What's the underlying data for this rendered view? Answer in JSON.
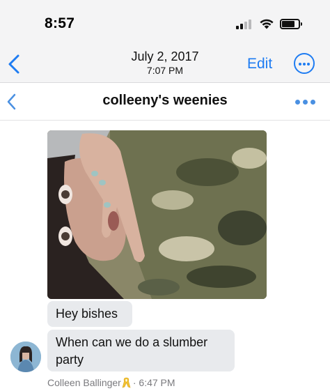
{
  "status_bar": {
    "time": "8:57",
    "signal_bars_filled": 2,
    "signal_bars_total": 4
  },
  "photo_viewer": {
    "date": "July 2, 2017",
    "time": "7:07 PM",
    "edit_label": "Edit",
    "back_icon": "chevron-left-icon",
    "more_icon": "more-circle-icon"
  },
  "conversation": {
    "title": "colleeny's weenies",
    "back_icon": "chevron-left-icon",
    "more_icon": "more-dots-icon"
  },
  "messages": [
    {
      "type": "photo",
      "description_icon": "photo-attachment"
    },
    {
      "type": "text",
      "text": "Hey bishes"
    },
    {
      "type": "text",
      "lines": [
        "When can we do a slumber",
        "party"
      ]
    }
  ],
  "sender": {
    "name": "Colleen Ballinger",
    "badge_icon": "awareness-ribbon-icon",
    "separator": "·",
    "timestamp": "6:47 PM"
  },
  "colors": {
    "accent": "#1e7cf2",
    "bubble": "#e8eaed",
    "meta": "#7a7a7e"
  }
}
